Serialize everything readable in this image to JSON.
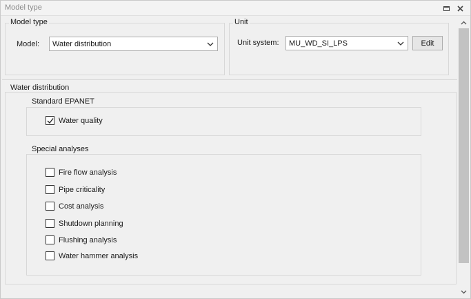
{
  "window": {
    "title": "Model type"
  },
  "model_type": {
    "legend": "Model type",
    "model_label": "Model:",
    "model_value": "Water distribution"
  },
  "unit": {
    "legend": "Unit",
    "unit_system_label": "Unit system:",
    "unit_system_value": "MU_WD_SI_LPS",
    "edit_label": "Edit"
  },
  "water_distribution": {
    "legend": "Water distribution",
    "standard_epanet": {
      "legend": "Standard EPANET",
      "options": [
        {
          "label": "Water quality",
          "checked": true
        }
      ]
    },
    "special_analyses": {
      "legend": "Special analyses",
      "options": [
        {
          "label": "Fire flow analysis",
          "checked": false
        },
        {
          "label": "Pipe criticality",
          "checked": false
        },
        {
          "label": "Cost analysis",
          "checked": false
        },
        {
          "label": "Shutdown planning",
          "checked": false
        },
        {
          "label": "Flushing analysis",
          "checked": false
        },
        {
          "label": "Water hammer analysis",
          "checked": false
        }
      ]
    }
  }
}
